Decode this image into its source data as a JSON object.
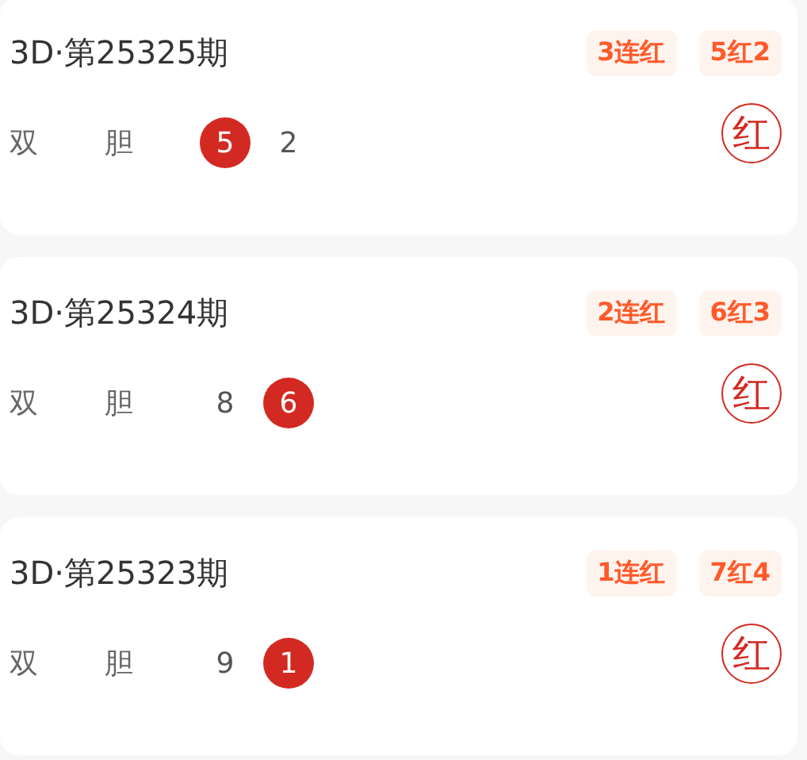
{
  "draws": [
    {
      "title": "3D·第25325期",
      "tags": [
        "3连红",
        "5红2"
      ],
      "labels": [
        "双",
        "胆"
      ],
      "numbers": [
        {
          "value": "5",
          "hit": true
        },
        {
          "value": "2",
          "hit": false
        }
      ],
      "result": "红"
    },
    {
      "title": "3D·第25324期",
      "tags": [
        "2连红",
        "6红3"
      ],
      "labels": [
        "双",
        "胆"
      ],
      "numbers": [
        {
          "value": "8",
          "hit": false
        },
        {
          "value": "6",
          "hit": true
        }
      ],
      "result": "红"
    },
    {
      "title": "3D·第25323期",
      "tags": [
        "1连红",
        "7红4"
      ],
      "labels": [
        "双",
        "胆"
      ],
      "numbers": [
        {
          "value": "9",
          "hit": false
        },
        {
          "value": "1",
          "hit": true
        }
      ],
      "result": "红"
    }
  ]
}
